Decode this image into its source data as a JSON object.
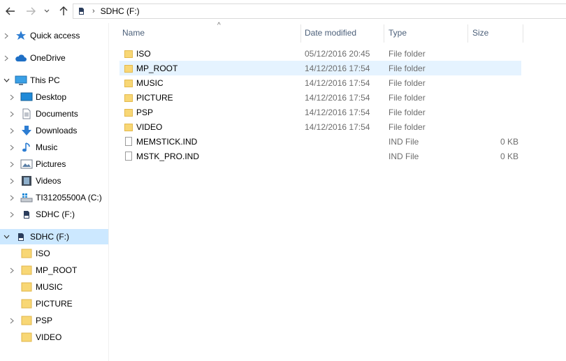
{
  "address": {
    "path": "SDHC (F:)",
    "separator": "›"
  },
  "nav": {
    "items": [
      {
        "label": "Quick access",
        "icon": "star-icon",
        "chevron": "right"
      },
      {
        "label": "OneDrive",
        "icon": "cloud-icon",
        "chevron": "right"
      },
      {
        "label": "This PC",
        "icon": "computer-icon",
        "chevron": "down"
      },
      {
        "label": "Desktop",
        "icon": "desktop-icon",
        "chevron": "right"
      },
      {
        "label": "Documents",
        "icon": "document-icon",
        "chevron": "right"
      },
      {
        "label": "Downloads",
        "icon": "download-arrow-icon",
        "chevron": "right"
      },
      {
        "label": "Music",
        "icon": "music-note-icon",
        "chevron": "right"
      },
      {
        "label": "Pictures",
        "icon": "pictures-icon",
        "chevron": "right"
      },
      {
        "label": "Videos",
        "icon": "film-icon",
        "chevron": "right"
      },
      {
        "label": "TI31205500A (C:)",
        "icon": "windows-drive-icon",
        "chevron": "right"
      },
      {
        "label": "SDHC (F:)",
        "icon": "sd-card-icon",
        "chevron": "right"
      },
      {
        "label": "SDHC (F:)",
        "icon": "sd-card-icon",
        "chevron": "down",
        "selected": true
      },
      {
        "label": "ISO",
        "icon": "folder-icon",
        "chevron": "none"
      },
      {
        "label": "MP_ROOT",
        "icon": "folder-icon",
        "chevron": "right"
      },
      {
        "label": "MUSIC",
        "icon": "folder-icon",
        "chevron": "none"
      },
      {
        "label": "PICTURE",
        "icon": "folder-icon",
        "chevron": "none"
      },
      {
        "label": "PSP",
        "icon": "folder-icon",
        "chevron": "right"
      },
      {
        "label": "VIDEO",
        "icon": "folder-icon",
        "chevron": "none"
      }
    ]
  },
  "columns": {
    "name": "Name",
    "date": "Date modified",
    "type": "Type",
    "size": "Size"
  },
  "files": [
    {
      "name": "ISO",
      "date": "05/12/2016 20:45",
      "type": "File folder",
      "size": "",
      "kind": "folder"
    },
    {
      "name": "MP_ROOT",
      "date": "14/12/2016 17:54",
      "type": "File folder",
      "size": "",
      "kind": "folder",
      "hover": true
    },
    {
      "name": "MUSIC",
      "date": "14/12/2016 17:54",
      "type": "File folder",
      "size": "",
      "kind": "folder"
    },
    {
      "name": "PICTURE",
      "date": "14/12/2016 17:54",
      "type": "File folder",
      "size": "",
      "kind": "folder"
    },
    {
      "name": "PSP",
      "date": "14/12/2016 17:54",
      "type": "File folder",
      "size": "",
      "kind": "folder"
    },
    {
      "name": "VIDEO",
      "date": "14/12/2016 17:54",
      "type": "File folder",
      "size": "",
      "kind": "folder"
    },
    {
      "name": "MEMSTICK.IND",
      "date": "",
      "type": "IND File",
      "size": "0 KB",
      "kind": "file"
    },
    {
      "name": "MSTK_PRO.IND",
      "date": "",
      "type": "IND File",
      "size": "0 KB",
      "kind": "file"
    }
  ],
  "colors": {
    "selection": "#cce8ff",
    "hover": "#e5f3ff",
    "header_text": "#4c607a",
    "folder": "#f8d775"
  }
}
